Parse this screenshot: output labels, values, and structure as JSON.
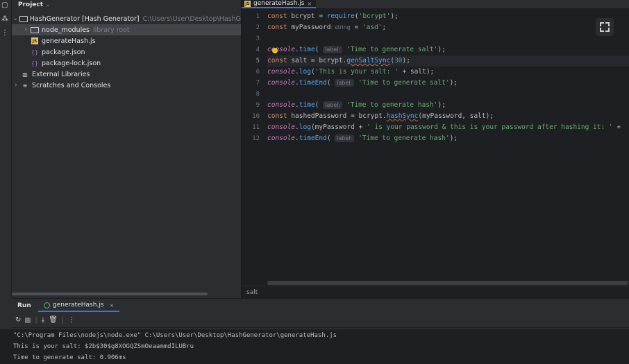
{
  "project_panel": {
    "title": "Project",
    "root": {
      "name": "HashGenerator [Hash Generator]",
      "path": "C:\\Users\\User\\Desktop\\HashG"
    },
    "items": [
      {
        "label": "node_modules",
        "note": "library root"
      },
      {
        "label": "generateHash.js"
      },
      {
        "label": "package.json"
      },
      {
        "label": "package-lock.json"
      }
    ],
    "external_libraries": "External Libraries",
    "scratches": "Scratches and Consoles"
  },
  "editor": {
    "tab": {
      "label": "generateHash.js",
      "close": "×"
    },
    "line_numbers": [
      "1",
      "2",
      "3",
      "4",
      "5",
      "6",
      "7",
      "8",
      "9",
      "10",
      "11",
      "12"
    ],
    "current_line": 5,
    "hints": {
      "label": "label:",
      "type_hint": ": string"
    },
    "code": {
      "l1_const": "const",
      "l1_var": " bcrypt = ",
      "l1_fn": "require",
      "l1_open": "(",
      "l1_str": "'bcrypt'",
      "l1_close": ");",
      "l2_const": "const",
      "l2_var": " myPassword",
      "l2_eq": " = ",
      "l2_str": "'asd'",
      "l2_end": ";",
      "l4_con": "console",
      "l4_dot": ".",
      "l4_fn": "time",
      "l4_open": "(",
      "l4_str": "'Time to generate salt'",
      "l4_end": ");",
      "l5_const": "const",
      "l5_var": " salt = bcrypt.",
      "l5_fn": "genSaltSync",
      "l5_open": "(",
      "l5_num": "30",
      "l5_end": ");",
      "l6_con": "console",
      "l6_dot": ".",
      "l6_fn": "log",
      "l6_open": "(",
      "l6_str": "'This is your salt: '",
      "l6_end": " + salt);",
      "l7_con": "console",
      "l7_dot": ".",
      "l7_fn": "timeEnd",
      "l7_open": "(",
      "l7_str": "'Time to generate salt'",
      "l7_end": ");",
      "l9_con": "console",
      "l9_dot": ".",
      "l9_fn": "time",
      "l9_open": "(",
      "l9_str": "'Time to generate hash'",
      "l9_end": ");",
      "l10_const": "const",
      "l10_var": " hashedPassword = bcrypt.",
      "l10_fn": "hashSync",
      "l10_end": "(myPassword, salt);",
      "l11_con": "console",
      "l11_dot": ".",
      "l11_fn": "log",
      "l11_mid": "(myPassword + ",
      "l11_str": "' is your password & this is your password after hashing it: '",
      "l11_end": " + ",
      "l12_con": "console",
      "l12_dot": ".",
      "l12_fn": "timeEnd",
      "l12_open": "(",
      "l12_str": "'Time to generate hash'",
      "l12_end": ");"
    },
    "breadcrumb": "salt"
  },
  "run_panel": {
    "title": "Run",
    "tab": {
      "label": "generateHash.js",
      "close": "×"
    },
    "output": [
      "\"C:\\Program Files\\nodejs\\node.exe\" C:\\Users\\User\\Desktop\\HashGenerator\\generateHash.js",
      "This is your salt: $2b$30$g8XOGQZSmOeaammdILUBru",
      "Time to generate salt: 0.906ms"
    ]
  },
  "colors": {
    "keyword": "#cf8e6d",
    "string": "#6aab73",
    "number": "#2aacb8",
    "function": "#56a8f5",
    "console_global": "#c77dbb",
    "accent": "#3574f0"
  }
}
